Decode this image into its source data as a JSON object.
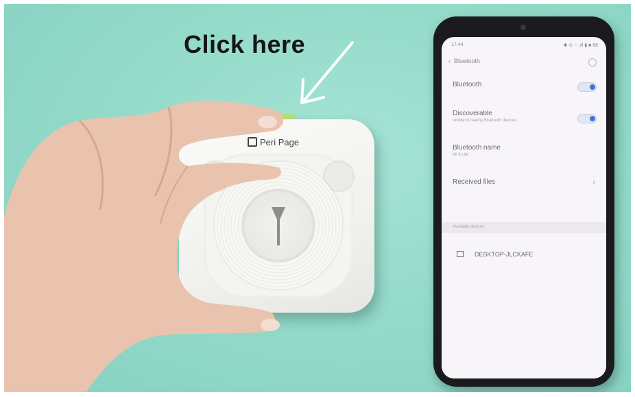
{
  "caption": "Click here",
  "printer": {
    "brand": "Peri Page"
  },
  "phone": {
    "status_time": "17:44",
    "status_icons": "✱ ⊙ ◔ .ıll ▮ ■ 66",
    "screen_title": "Bluetooth",
    "settings": [
      {
        "label": "Bluetooth",
        "sub": "",
        "control": "toggle",
        "on": true
      },
      {
        "label": "Discoverable",
        "sub": "Visible to nearby Bluetooth devices",
        "control": "toggle",
        "on": true
      },
      {
        "label": "Bluetooth name",
        "sub": "MI 8 Lite",
        "control": "none"
      },
      {
        "label": "Received files",
        "sub": "",
        "control": "chevron"
      }
    ],
    "section_header": "Available devices",
    "devices": [
      {
        "name": "DESKTOP-JLCKAFE",
        "icon": "laptop-icon"
      }
    ],
    "colors": {
      "toggle_on": "#3a78d4",
      "screen_bg": "#f7f5f8"
    }
  },
  "colors": {
    "background": "#92d9c8",
    "printer_button": "#b7e07a"
  }
}
